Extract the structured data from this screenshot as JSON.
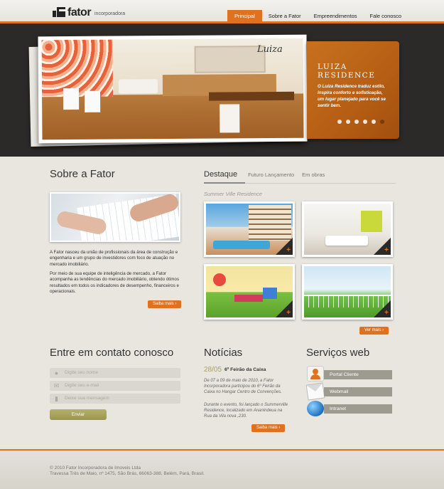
{
  "header": {
    "logo_name": "fator",
    "logo_sub": "incorporadora",
    "nav": [
      "Principal",
      "Sobre a Fator",
      "Empreendimentos",
      "Fale conosco"
    ]
  },
  "hero": {
    "sign": "Luiza",
    "feature_title": "LUIZA RESIDENCE",
    "feature_text": "O Luiza Residence traduz estilo, inspira conforto e sofisticação, um lugar planejado para você se sentir bem.",
    "slides_total": 6,
    "slide_active": 6
  },
  "sobre": {
    "title": "Sobre a Fator",
    "p1": "A Fator nasceu da união de profissionais da área de construção e engenharia e um grupo de investidores com foco de atuação no mercado imobiliário.",
    "p2": "Por meio de sua equipe de inteligência de mercado, a Fator acompanha as tendências do mercado imobiliário, obtendo ótimos resultados em todos os indicadores de desempenho, financeiros e operacionais.",
    "more": "Saiba mais"
  },
  "destaque": {
    "tabs": [
      "Destaque",
      "Futuro Lançamento",
      "Em obras"
    ],
    "subtitle": "Summer Ville Residence",
    "more": "Ver mais"
  },
  "contato": {
    "title": "Entre em contato conosco",
    "nome_placeholder": "Digite seu nome",
    "email_placeholder": "Digite seu e-mail",
    "msg_placeholder": "Deixe sua mensagem",
    "send": "Enviar"
  },
  "noticias": {
    "title": "Notícias",
    "date": "28/05",
    "headline": "6º Feirão da Caixa",
    "p1": "De 07 a 09 de maio de 2010, a Fator Incorporadora participou do 6º Feirão da Caixa no Hangar Centro de Convenções.",
    "p2": "Durante o evento, foi lançado o Summerville Residence, localizado em Ananindeua na Rua da Vila nova ,230.",
    "more": "Saiba mais"
  },
  "servicos": {
    "title": "Serviços web",
    "items": [
      "Portal Cliente",
      "Webmail",
      "Intranet"
    ]
  },
  "footer": {
    "copyright": "© 2010 Fator Incorporadora de Imoveis Ltda",
    "address": "Travessa Três de Maio, nº 1475, São Brás, 66063-388, Belém, Pará, Brasil."
  },
  "colors": {
    "accent": "#e0711f",
    "dark": "#2b2a28",
    "olive": "#9a9651"
  }
}
